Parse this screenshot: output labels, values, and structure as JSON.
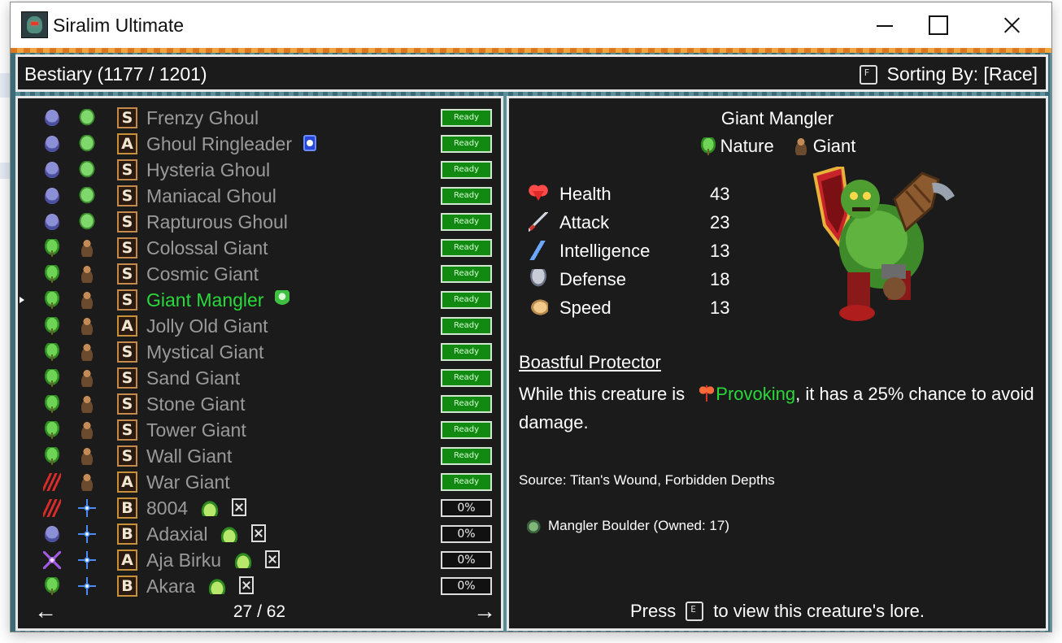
{
  "window": {
    "title": "Siralim Ultimate"
  },
  "header": {
    "title": "Bestiary (1177 / 1201)",
    "sort_key": "F",
    "sort_label": "Sorting By: [Race]"
  },
  "list": {
    "rows": [
      {
        "race_icon": "skull-icon",
        "type_icon": "brain-icon",
        "class": "S",
        "name": "Frenzy Ghoul",
        "status": "Ready",
        "selected": false
      },
      {
        "race_icon": "skull-icon",
        "type_icon": "brain-icon",
        "class": "A",
        "name": "Ghoul Ringleader",
        "status": "Ready",
        "badge": "ghost-card-icon",
        "selected": false
      },
      {
        "race_icon": "skull-icon",
        "type_icon": "brain-icon",
        "class": "S",
        "name": "Hysteria Ghoul",
        "status": "Ready",
        "selected": false
      },
      {
        "race_icon": "skull-icon",
        "type_icon": "brain-icon",
        "class": "S",
        "name": "Maniacal Ghoul",
        "status": "Ready",
        "selected": false
      },
      {
        "race_icon": "skull-icon",
        "type_icon": "brain-icon",
        "class": "S",
        "name": "Rapturous Ghoul",
        "status": "Ready",
        "selected": false
      },
      {
        "race_icon": "leaf-icon",
        "type_icon": "giant-icon",
        "class": "S",
        "name": "Colossal Giant",
        "status": "Ready",
        "selected": false
      },
      {
        "race_icon": "leaf-icon",
        "type_icon": "giant-icon",
        "class": "S",
        "name": "Cosmic Giant",
        "status": "Ready",
        "selected": false
      },
      {
        "race_icon": "leaf-icon",
        "type_icon": "giant-icon",
        "class": "S",
        "name": "Giant Mangler",
        "status": "Ready",
        "badge": "green-card-icon",
        "selected": true
      },
      {
        "race_icon": "leaf-icon",
        "type_icon": "giant-icon",
        "class": "A",
        "name": "Jolly Old Giant",
        "status": "Ready",
        "selected": false
      },
      {
        "race_icon": "leaf-icon",
        "type_icon": "giant-icon",
        "class": "S",
        "name": "Mystical Giant",
        "status": "Ready",
        "selected": false
      },
      {
        "race_icon": "leaf-icon",
        "type_icon": "giant-icon",
        "class": "S",
        "name": "Sand Giant",
        "status": "Ready",
        "selected": false
      },
      {
        "race_icon": "leaf-icon",
        "type_icon": "giant-icon",
        "class": "S",
        "name": "Stone Giant",
        "status": "Ready",
        "selected": false
      },
      {
        "race_icon": "leaf-icon",
        "type_icon": "giant-icon",
        "class": "S",
        "name": "Tower Giant",
        "status": "Ready",
        "selected": false
      },
      {
        "race_icon": "leaf-icon",
        "type_icon": "giant-icon",
        "class": "S",
        "name": "Wall Giant",
        "status": "Ready",
        "selected": false
      },
      {
        "race_icon": "claw-icon",
        "type_icon": "giant-icon",
        "class": "A",
        "name": "War Giant",
        "status": "Ready",
        "selected": false
      },
      {
        "race_icon": "claw-icon",
        "type_icon": "spark-icon",
        "class": "B",
        "name": "8004",
        "status": "0%",
        "badge": "slime-icon",
        "extra": "x-box-icon",
        "selected": false
      },
      {
        "race_icon": "skull-icon",
        "type_icon": "spark-icon",
        "class": "B",
        "name": "Adaxial",
        "status": "0%",
        "badge": "slime-icon",
        "extra": "x-box-icon",
        "selected": false
      },
      {
        "race_icon": "star-icon",
        "type_icon": "spark-icon",
        "class": "A",
        "name": "Aja Birku",
        "status": "0%",
        "badge": "slime-icon",
        "extra": "x-box-icon",
        "selected": false
      },
      {
        "race_icon": "leaf-icon",
        "type_icon": "spark-icon",
        "class": "B",
        "name": "Akara",
        "status": "0%",
        "badge": "slime-icon",
        "extra": "x-box-icon",
        "selected": false
      }
    ],
    "pager": {
      "text": "27 / 62",
      "prev": "←",
      "next": "→"
    }
  },
  "detail": {
    "name": "Giant Mangler",
    "types": [
      {
        "icon": "nature-leaf-icon",
        "label": "Nature"
      },
      {
        "icon": "giant-race-icon",
        "label": "Giant"
      }
    ],
    "stats": [
      {
        "icon": "heart-icon",
        "label": "Health",
        "value": "43"
      },
      {
        "icon": "sword-icon",
        "label": "Attack",
        "value": "23"
      },
      {
        "icon": "lightning-icon",
        "label": "Intelligence",
        "value": "13"
      },
      {
        "icon": "shield-icon",
        "label": "Defense",
        "value": "18"
      },
      {
        "icon": "wing-icon",
        "label": "Speed",
        "value": "13"
      }
    ],
    "trait": {
      "title": "Boastful Protector",
      "desc_before": "While this creature is ",
      "desc_highlight": "Provoking",
      "desc_after": ", it has a 25% chance to avoid damage."
    },
    "source": "Source: Titan's Wound, Forbidden Depths",
    "item": "Mangler Boulder (Owned: 17)",
    "lore": {
      "before": "Press",
      "key": "E",
      "after": "to view this creature's lore."
    }
  },
  "colors": {
    "highlight": "#29d93a",
    "ready": "#128a12",
    "panel": "#1b1b1b"
  }
}
